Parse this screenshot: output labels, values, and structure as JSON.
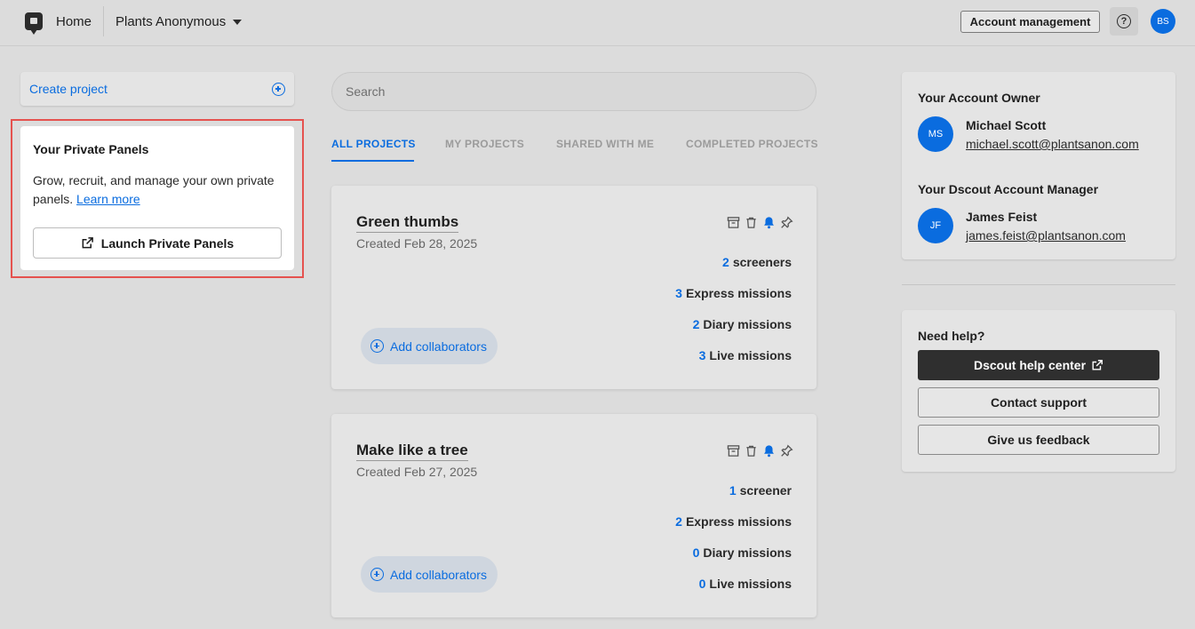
{
  "topbar": {
    "home_label": "Home",
    "workspace_name": "Plants Anonymous",
    "account_button": "Account management",
    "help_symbol": "?",
    "user_initials": "BS"
  },
  "sidebar": {
    "create_project": "Create project",
    "private_panels": {
      "title": "Your Private Panels",
      "description": "Grow, recruit, and manage your own private panels.",
      "learn_more": "Learn more",
      "launch_button": "Launch Private Panels"
    }
  },
  "main": {
    "search_placeholder": "Search",
    "tabs": [
      {
        "label": "ALL PROJECTS",
        "active": true
      },
      {
        "label": "MY PROJECTS",
        "active": false
      },
      {
        "label": "SHARED WITH ME",
        "active": false
      },
      {
        "label": "COMPLETED PROJECTS",
        "active": false
      }
    ],
    "projects": [
      {
        "title": "Green thumbs",
        "created": "Created Feb 28, 2025",
        "stats": [
          {
            "num": "2",
            "label": "screeners"
          },
          {
            "num": "3",
            "label": "Express missions"
          },
          {
            "num": "2",
            "label": "Diary missions"
          },
          {
            "num": "3",
            "label": "Live missions"
          }
        ],
        "collab_label": "Add collaborators"
      },
      {
        "title": "Make like a tree",
        "created": "Created Feb 27, 2025",
        "stats": [
          {
            "num": "1",
            "label": "screener"
          },
          {
            "num": "2",
            "label": "Express missions"
          },
          {
            "num": "0",
            "label": "Diary missions"
          },
          {
            "num": "0",
            "label": "Live missions"
          }
        ],
        "collab_label": "Add collaborators"
      }
    ]
  },
  "right": {
    "owner": {
      "heading": "Your Account Owner",
      "initials": "MS",
      "name": "Michael Scott",
      "email": "michael.scott@plantsanon.com"
    },
    "manager": {
      "heading": "Your Dscout Account Manager",
      "initials": "JF",
      "name": "James Feist",
      "email": "james.feist@plantsanon.com"
    },
    "help": {
      "heading": "Need help?",
      "help_center": "Dscout help center",
      "contact": "Contact support",
      "feedback": "Give us feedback"
    }
  },
  "colors": {
    "accent": "#0a6cdf",
    "highlight": "#e5524f",
    "background": "#dcdcdc"
  }
}
